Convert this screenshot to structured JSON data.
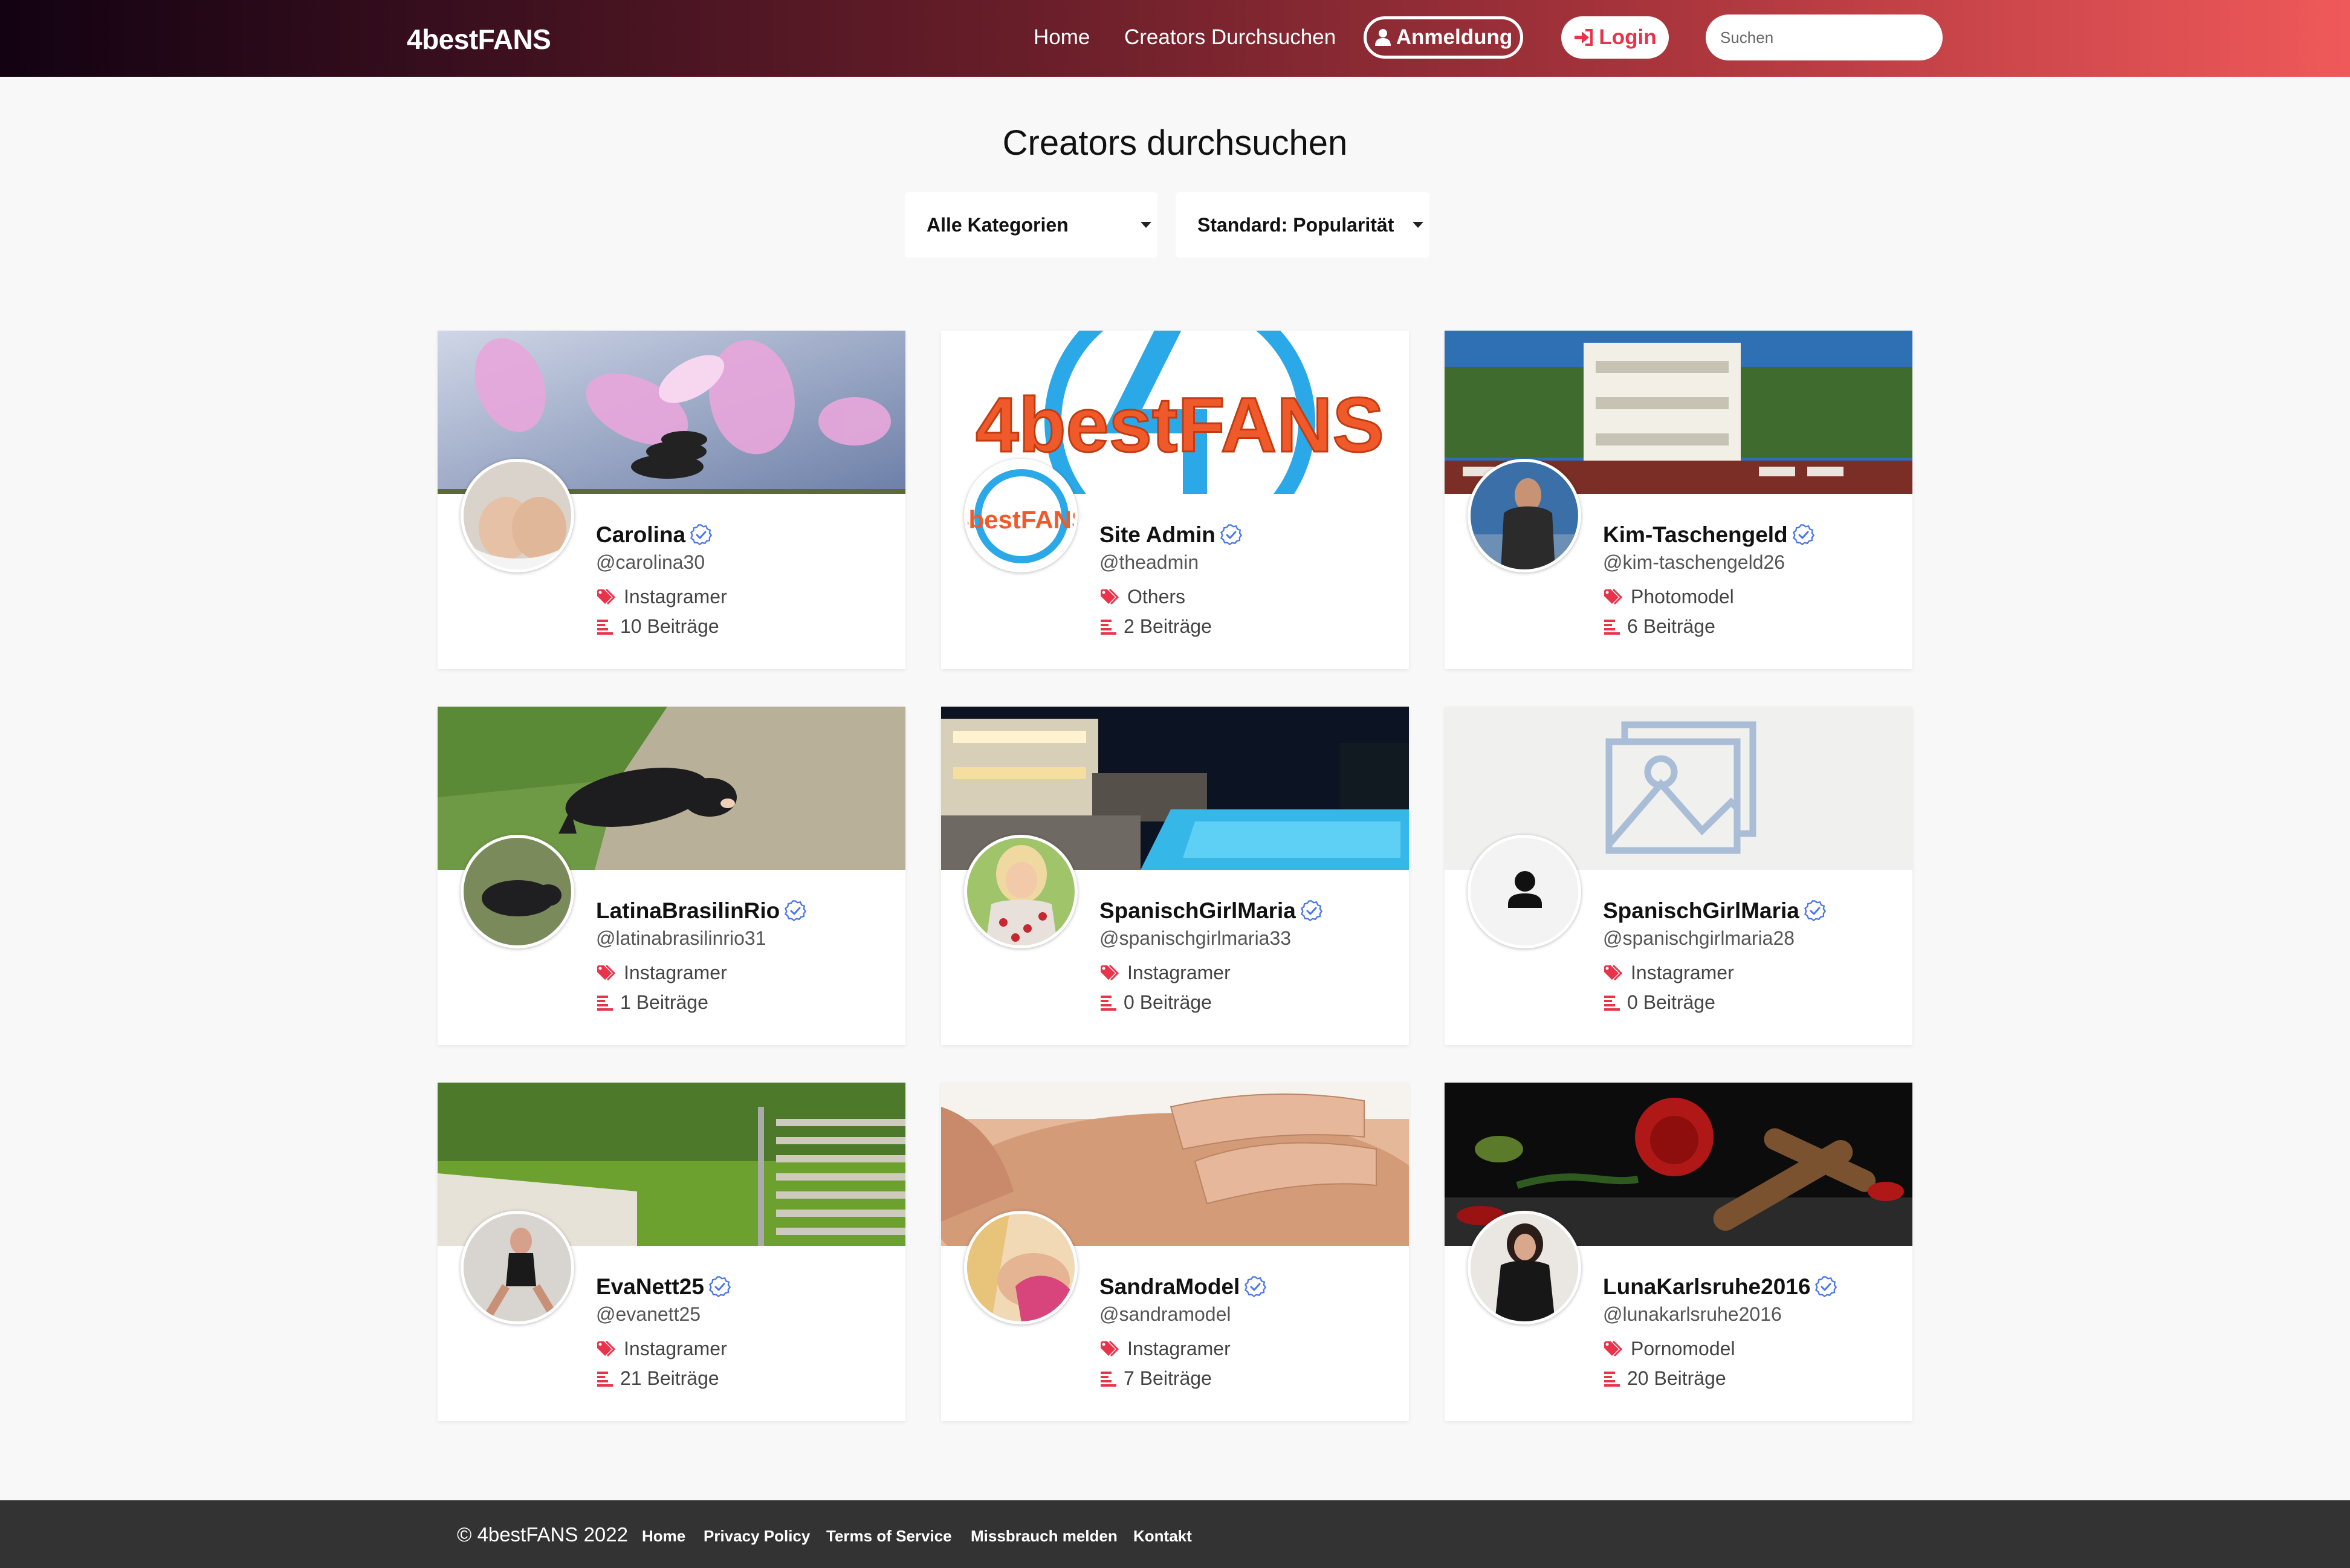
{
  "navbar": {
    "brand": "4bestFANS",
    "links": [
      "Home",
      "Creators Durchsuchen"
    ],
    "signup_label": "Anmeldung",
    "login_label": "Login",
    "search_placeholder": "Suchen"
  },
  "page_title": "Creators durchsuchen",
  "filters": {
    "category_selected": "Alle Kategorien",
    "sort_selected": "Standard: Popularität"
  },
  "colors": {
    "accent": "#e8334a",
    "verified": "#4a78e8",
    "navbar_start": "#120212",
    "navbar_end": "#f0595a",
    "footer_bg": "#333333"
  },
  "creators": [
    {
      "name": "Carolina",
      "handle": "@carolina30",
      "category": "Instagramer",
      "posts": "10 Beiträge",
      "cover": "orchid-photo",
      "avatar": "photo"
    },
    {
      "name": "Site Admin",
      "handle": "@theadmin",
      "category": "Others",
      "posts": "2 Beiträge",
      "cover": "brand-logo",
      "avatar": "brand-logo"
    },
    {
      "name": "Kim-Taschengeld",
      "handle": "@kim-taschengeld26",
      "category": "Photomodel",
      "posts": "6 Beiträge",
      "cover": "villa-photo",
      "avatar": "photo"
    },
    {
      "name": "LatinaBrasilinRio",
      "handle": "@latinabrasilinrio31",
      "category": "Instagramer",
      "posts": "1 Beiträge",
      "cover": "dog-on-grass-photo",
      "avatar": "photo"
    },
    {
      "name": "SpanischGirlMaria",
      "handle": "@spanischgirlmaria33",
      "category": "Instagramer",
      "posts": "0 Beiträge",
      "cover": "pool-night-photo",
      "avatar": "photo"
    },
    {
      "name": "SpanischGirlMaria",
      "handle": "@spanischgirlmaria28",
      "category": "Instagramer",
      "posts": "0 Beiträge",
      "cover": "image-placeholder",
      "avatar": "user-placeholder"
    },
    {
      "name": "EvaNett25",
      "handle": "@evanett25",
      "category": "Instagramer",
      "posts": "21 Beiträge",
      "cover": "garden-stairs-photo",
      "avatar": "photo"
    },
    {
      "name": "SandraModel",
      "handle": "@sandramodel",
      "category": "Instagramer",
      "posts": "7 Beiträge",
      "cover": "massage-photo",
      "avatar": "photo"
    },
    {
      "name": "LunaKarlsruhe2016",
      "handle": "@lunakarlsruhe2016",
      "category": "Pornomodel",
      "posts": "20 Beiträge",
      "cover": "roses-cigars-photo",
      "avatar": "photo"
    }
  ],
  "footer": {
    "copyright": "© 4bestFANS 2022",
    "links": [
      "Home",
      "Privacy Policy",
      "Terms of Service",
      "Missbrauch melden",
      "Kontakt"
    ]
  }
}
